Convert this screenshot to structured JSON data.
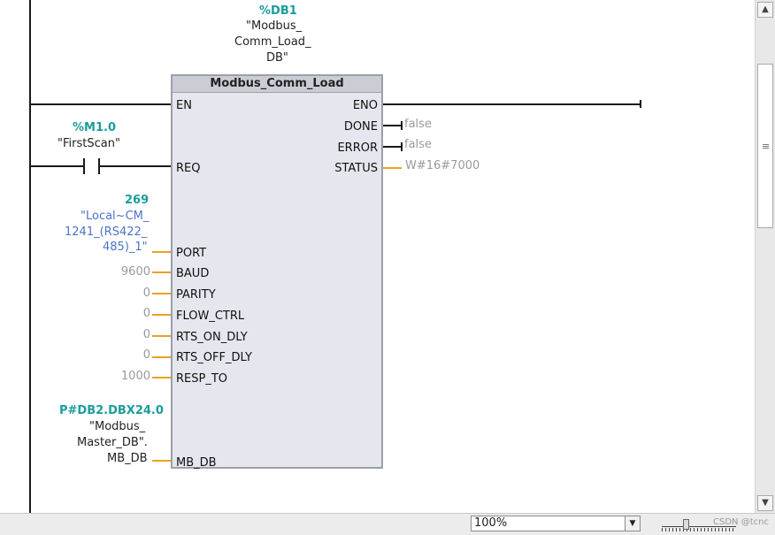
{
  "instance": {
    "db_address": "%DB1",
    "db_name_lines": [
      "\"Modbus_",
      "Comm_Load_",
      "DB\""
    ]
  },
  "block": {
    "title": "Modbus_Comm_Load",
    "inputs": {
      "en": "EN",
      "req": "REQ",
      "port": "PORT",
      "baud": "BAUD",
      "parity": "PARITY",
      "flow_ctrl": "FLOW_CTRL",
      "rts_on_dly": "RTS_ON_DLY",
      "rts_off_dly": "RTS_OFF_DLY",
      "resp_to": "RESP_TO",
      "mb_db": "MB_DB"
    },
    "outputs": {
      "eno": "ENO",
      "done": "DONE",
      "error": "ERROR",
      "status": "STATUS"
    }
  },
  "req_contact": {
    "address": "%M1.0",
    "name": "\"FirstScan\""
  },
  "port_param": {
    "value": "269",
    "name_lines": [
      "\"Local~CM_",
      "1241_(RS422_",
      "485)_1\""
    ]
  },
  "constants": {
    "baud": "9600",
    "parity": "0",
    "flow_ctrl": "0",
    "rts_on_dly": "0",
    "rts_off_dly": "0",
    "resp_to": "1000"
  },
  "mb_db_param": {
    "address": "P#DB2.DBX24.0",
    "name_lines": [
      "\"Modbus_",
      "Master_DB\".",
      "MB_DB"
    ]
  },
  "output_values": {
    "done": "false",
    "error": "false",
    "status": "W#16#7000"
  },
  "statusbar": {
    "zoom": "100%"
  },
  "icons": [
    "scroll-up-icon",
    "scroll-down-icon",
    "grip-icon",
    "dropdown-arrow-icon"
  ],
  "watermark": "CSDN @tcnc",
  "colors": {
    "address": "#1b9c9c",
    "port_tag": "#4a74c8",
    "wire": "#f0a020",
    "block_bg": "#e6e6ee"
  }
}
